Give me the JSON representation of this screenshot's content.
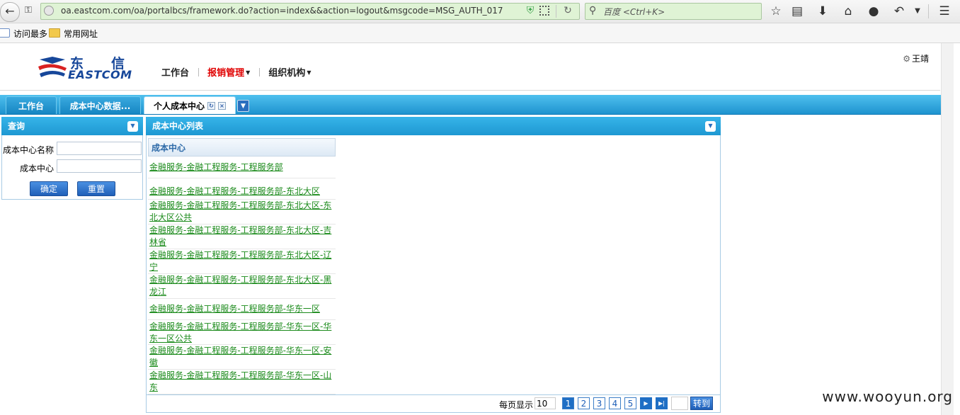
{
  "browser": {
    "url": "oa.eastcom.com/oa/portalbcs/framework.do?action=index&&action=logout&msgcode=MSG_AUTH_017",
    "search_placeholder": "百度 <Ctrl+K>",
    "bookmarks": [
      "访问最多",
      "常用网址"
    ]
  },
  "header": {
    "logo_cn_1": "东",
    "logo_cn_2": "信",
    "logo_en": "EASTCOM",
    "nav": [
      {
        "label": "工作台"
      },
      {
        "label": "报销管理"
      },
      {
        "label": "组织机构"
      }
    ],
    "user_name": "王靖"
  },
  "tabs": [
    {
      "label": "工作台"
    },
    {
      "label": "成本中心数据..."
    },
    {
      "label": "个人成本中心"
    }
  ],
  "query_panel": {
    "title": "查询",
    "fields": [
      {
        "label": "成本中心名称",
        "value": ""
      },
      {
        "label": "成本中心",
        "value": ""
      }
    ],
    "confirm_label": "确定",
    "reset_label": "重置"
  },
  "list_panel": {
    "title": "成本中心列表",
    "column_header": "成本中心",
    "rows": [
      "金融服务-金融工程服务-工程服务部",
      "金融服务-金融工程服务-工程服务部-东北大区",
      "金融服务-金融工程服务-工程服务部-东北大区-东北大区公共",
      "金融服务-金融工程服务-工程服务部-东北大区-吉林省",
      "金融服务-金融工程服务-工程服务部-东北大区-辽宁",
      "金融服务-金融工程服务-工程服务部-东北大区-黑龙江",
      "金融服务-金融工程服务-工程服务部-华东一区",
      "金融服务-金融工程服务-工程服务部-华东一区-华东一区公共",
      "金融服务-金融工程服务-工程服务部-华东一区-安徽",
      "金融服务-金融工程服务-工程服务部-华东一区-山东"
    ]
  },
  "pager": {
    "per_page_label": "每页显示",
    "page_size": "10",
    "pages": [
      "1",
      "2",
      "3",
      "4",
      "5"
    ],
    "current_page": "1",
    "goto_label": "转到"
  },
  "watermark": "www.wooyun.org",
  "colors": {
    "accent": "#1e98d2",
    "link": "#1a8a1a",
    "active_nav": "#e00000",
    "brand": "#17479a"
  }
}
